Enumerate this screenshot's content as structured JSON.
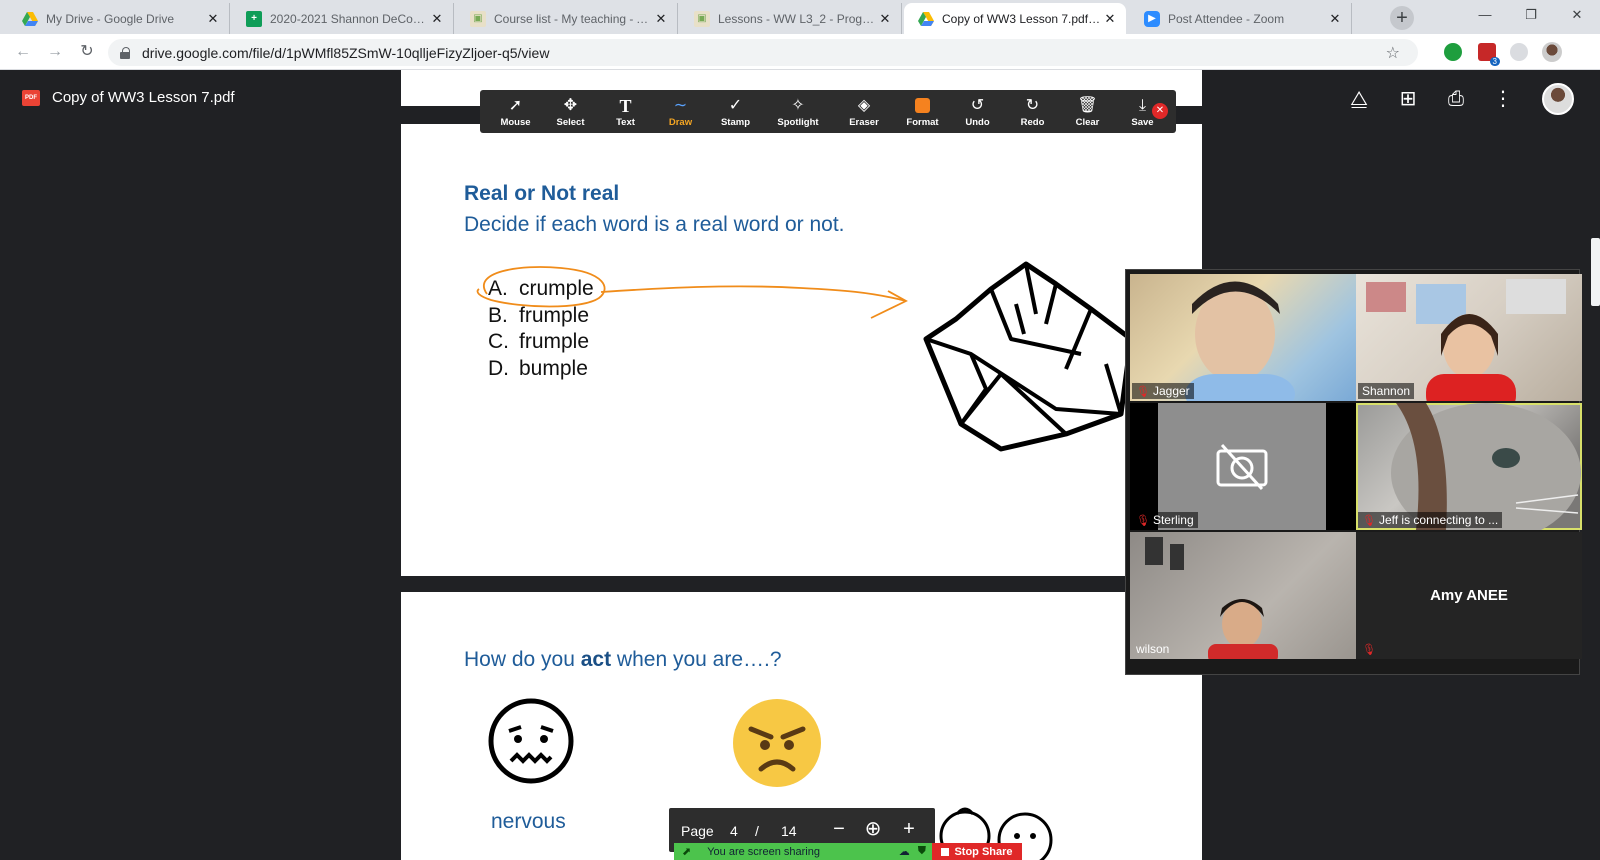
{
  "browser": {
    "tabs": [
      {
        "title": "My Drive - Google Drive",
        "favicon": "drive-icon"
      },
      {
        "title": "2020-2021 Shannon DeConkey",
        "favicon": "sheets-icon"
      },
      {
        "title": "Course list - My teaching - Aca",
        "favicon": "course-icon"
      },
      {
        "title": "Lessons - WW L3_2 - Programs",
        "favicon": "lessons-icon"
      },
      {
        "title": "Copy of WW3 Lesson 7.pdf - G",
        "favicon": "drive-icon"
      },
      {
        "title": "Post Attendee - Zoom",
        "favicon": "zoom-icon"
      }
    ],
    "url": "drive.google.com/file/d/1pWMfl85ZSmW-10qlljeFizyZljoer-q5/view",
    "extension_badge": "3"
  },
  "viewer": {
    "filename": "Copy of WW3 Lesson 7.pdf"
  },
  "annotate_toolbar": [
    {
      "label": "Mouse",
      "icon": "cursor-icon"
    },
    {
      "label": "Select",
      "icon": "move-icon"
    },
    {
      "label": "Text",
      "icon": "text-icon"
    },
    {
      "label": "Draw",
      "icon": "draw-icon"
    },
    {
      "label": "Stamp",
      "icon": "stamp-icon"
    },
    {
      "label": "Spotlight",
      "icon": "spotlight-icon"
    },
    {
      "label": "Eraser",
      "icon": "eraser-icon"
    },
    {
      "label": "Format",
      "icon": "format-icon"
    },
    {
      "label": "Undo",
      "icon": "undo-icon"
    },
    {
      "label": "Redo",
      "icon": "redo-icon"
    },
    {
      "label": "Clear",
      "icon": "trash-icon"
    },
    {
      "label": "Save",
      "icon": "save-icon"
    }
  ],
  "pdf": {
    "page1": {
      "title": "Real or Not real",
      "subtitle": "Decide if each word is a real word or not.",
      "options": [
        {
          "letter": "A.",
          "word": "crumple"
        },
        {
          "letter": "B.",
          "word": "frumple"
        },
        {
          "letter": "C.",
          "word": "frumple"
        },
        {
          "letter": "D.",
          "word": "bumple"
        }
      ]
    },
    "page2": {
      "question_pre": "How do you ",
      "question_bold": "act",
      "question_post": " when you are….?",
      "labels": [
        "nervous",
        "angry"
      ]
    }
  },
  "zoom": {
    "participants": [
      "Jagger",
      "Shannon",
      "Sterling",
      "Jeff is connecting to ...",
      "wilson",
      "Amy ANEE"
    ],
    "page_label": "Page",
    "page_current": "4",
    "page_sep": "/",
    "page_total": "14",
    "sharing_text": "You are screen sharing",
    "stop_share": "Stop Share"
  },
  "colors": {
    "heading_blue": "#1f5c99",
    "annotation_orange": "#f08c1a",
    "share_green": "#4cc34c",
    "stop_red": "#e02828"
  }
}
